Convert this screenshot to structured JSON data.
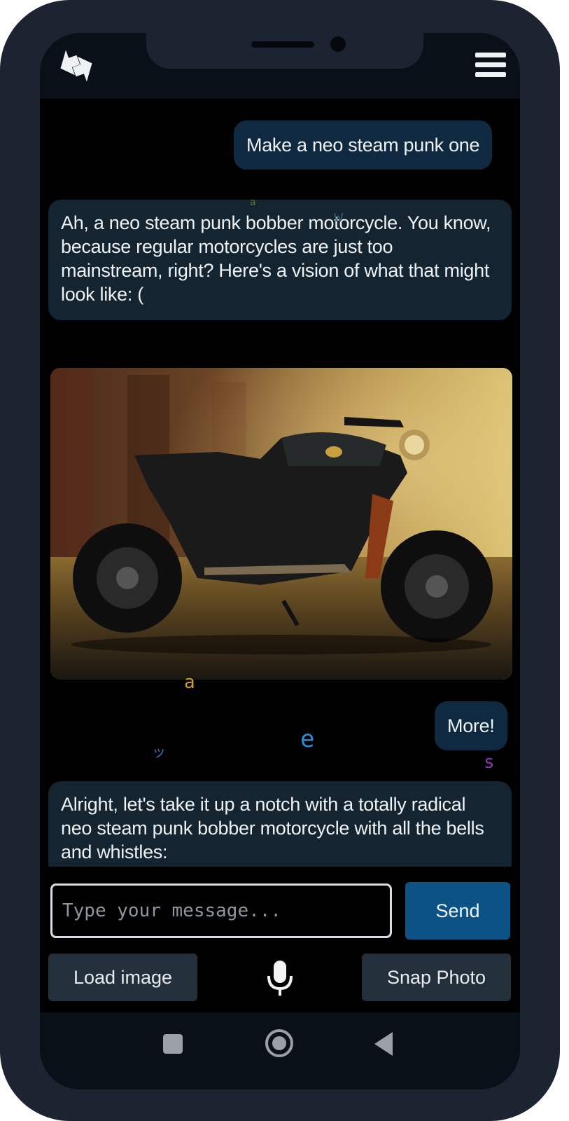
{
  "app": {
    "logo_icon": "two-arrows-swap-icon",
    "menu_icon": "hamburger-menu-icon"
  },
  "messages": [
    {
      "role": "user",
      "text": "Make a neo steam punk one"
    },
    {
      "role": "assistant",
      "text": "Ah, a neo steam punk bobber motorcycle. You know, because regular motorcycles are just too mainstream, right? Here's a vision of what that might look like: ("
    },
    {
      "role": "assistant",
      "image": "generated-motorcycle-image"
    },
    {
      "role": "user",
      "text": "More!"
    },
    {
      "role": "assistant",
      "text": "Alright, let's take it up a notch with a totally radical neo steam punk bobber motorcycle with all the bells and whistles:"
    }
  ],
  "floating_glyphs": [
    {
      "char": "a",
      "color": "#5a7a3a"
    },
    {
      "char": "w",
      "color": "#3a5a6a"
    },
    {
      "char": "a",
      "color": "#c9a020"
    },
    {
      "char": "ッ",
      "color": "#3a72b0"
    },
    {
      "char": "e",
      "color": "#2a8ad8"
    },
    {
      "char": "s",
      "color": "#8a3ab0"
    },
    {
      "char": ">",
      "color": "#b8c020"
    },
    {
      "char": "$$",
      "color": "#6a7a40"
    }
  ],
  "composer": {
    "placeholder": "Type your message...",
    "send_label": "Send",
    "load_image_label": "Load image",
    "snap_photo_label": "Snap Photo",
    "mic_icon": "microphone-icon"
  },
  "navbar": {
    "recents_icon": "square-recents-icon",
    "home_icon": "circle-home-icon",
    "back_icon": "triangle-back-icon"
  },
  "colors": {
    "background": "#000000",
    "user_bubble": "#0f2a40",
    "assistant_bubble": "#142430",
    "send_button": "#0c5285",
    "secondary_button": "#232f3a",
    "frame": "#1b2430"
  }
}
